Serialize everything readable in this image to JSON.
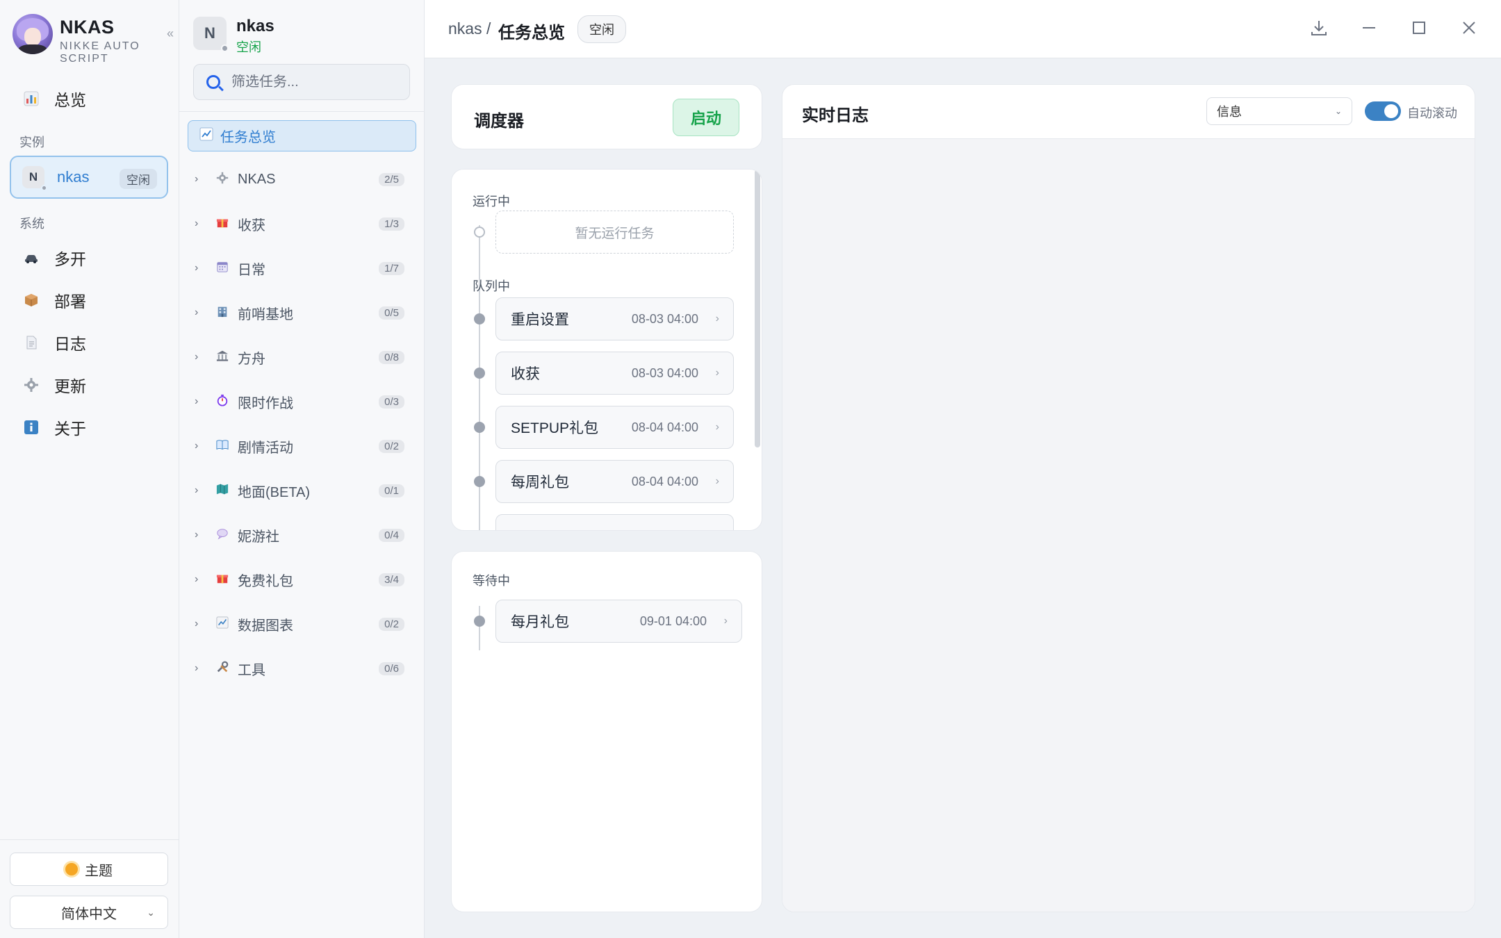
{
  "app": {
    "title": "NKAS",
    "subtitle": "NIKKE AUTO SCRIPT",
    "collapse_glyph": "«"
  },
  "nav": {
    "overview": "总览",
    "section_instance": "实例",
    "section_system": "系统",
    "system_items": [
      "多开",
      "部署",
      "日志",
      "更新",
      "关于"
    ]
  },
  "instance": {
    "initial": "N",
    "name": "nkas",
    "status": "空闲"
  },
  "footer": {
    "theme_label": "主题",
    "language": "简体中文"
  },
  "task_panel": {
    "instance_initial": "N",
    "instance_name": "nkas",
    "instance_status": "空闲",
    "search_placeholder": "筛选任务...",
    "overview_item": "任务总览",
    "groups": [
      {
        "label": "NKAS",
        "count": "2/5",
        "icon": "gear-icon"
      },
      {
        "label": "收获",
        "count": "1/3",
        "icon": "gift-icon"
      },
      {
        "label": "日常",
        "count": "1/7",
        "icon": "calendar-icon"
      },
      {
        "label": "前哨基地",
        "count": "0/5",
        "icon": "building-icon"
      },
      {
        "label": "方舟",
        "count": "0/8",
        "icon": "bank-icon"
      },
      {
        "label": "限时作战",
        "count": "0/3",
        "icon": "stopwatch-icon"
      },
      {
        "label": "剧情活动",
        "count": "0/2",
        "icon": "book-icon"
      },
      {
        "label": "地面(BETA)",
        "count": "0/1",
        "icon": "map-icon"
      },
      {
        "label": "妮游社",
        "count": "0/4",
        "icon": "chat-bubble-icon"
      },
      {
        "label": "免费礼包",
        "count": "3/4",
        "icon": "gift-icon"
      },
      {
        "label": "数据图表",
        "count": "0/2",
        "icon": "chart-icon"
      },
      {
        "label": "工具",
        "count": "0/6",
        "icon": "tools-icon"
      }
    ]
  },
  "topbar": {
    "breadcrumb_instance": "nkas /",
    "page_title": "任务总览",
    "status_badge": "空闲"
  },
  "scheduler": {
    "title": "调度器",
    "start_label": "启动"
  },
  "queue": {
    "running_label": "运行中",
    "running_empty": "暂无运行任务",
    "queued_label": "队列中",
    "queued": [
      {
        "name": "重启设置",
        "time": "08-03 04:00"
      },
      {
        "name": "收获",
        "time": "08-03 04:00"
      },
      {
        "name": "SETPUP礼包",
        "time": "08-04 04:00"
      },
      {
        "name": "每周礼包",
        "time": "08-04 04:00"
      }
    ],
    "waiting_label": "等待中",
    "waiting": [
      {
        "name": "每月礼包",
        "time": "09-01 04:00"
      }
    ]
  },
  "log": {
    "title": "实时日志",
    "level": "信息",
    "auto_scroll_label": "自动滚动",
    "auto_scroll_on": true
  },
  "colors": {
    "accent": "#2f7dd0",
    "success": "#16a34a",
    "toggle_on": "#3b82c4"
  }
}
